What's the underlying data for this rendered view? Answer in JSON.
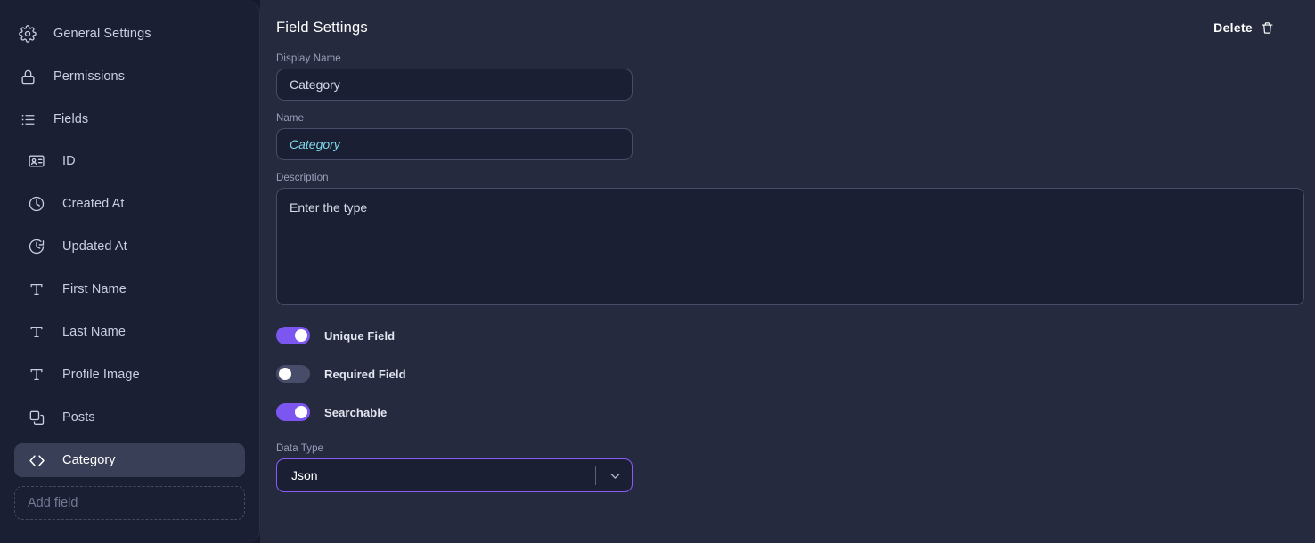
{
  "sidebar": {
    "nav": [
      {
        "label": "General Settings",
        "icon": "gear-icon"
      },
      {
        "label": "Permissions",
        "icon": "lock-icon"
      },
      {
        "label": "Fields",
        "icon": "list-icon"
      }
    ],
    "fields": [
      {
        "label": "ID",
        "icon": "id-card-icon",
        "active": false
      },
      {
        "label": "Created At",
        "icon": "clock-icon",
        "active": false
      },
      {
        "label": "Updated At",
        "icon": "clock-refresh-icon",
        "active": false
      },
      {
        "label": "First Name",
        "icon": "text-icon",
        "active": false
      },
      {
        "label": "Last Name",
        "icon": "text-icon",
        "active": false
      },
      {
        "label": "Profile Image",
        "icon": "text-icon",
        "active": false
      },
      {
        "label": "Posts",
        "icon": "copy-icon",
        "active": false
      },
      {
        "label": "Category",
        "icon": "code-icon",
        "active": true
      }
    ],
    "add_field_label": "Add field"
  },
  "header": {
    "title": "Field Settings",
    "delete_label": "Delete",
    "delete_icon": "trash-icon"
  },
  "form": {
    "display_name": {
      "label": "Display Name",
      "value": "Category",
      "placeholder": ""
    },
    "name": {
      "label": "Name",
      "value": "Category",
      "placeholder": ""
    },
    "description": {
      "label": "Description",
      "value": "Enter the type",
      "placeholder": ""
    },
    "toggles": [
      {
        "label": "Unique Field",
        "on": true
      },
      {
        "label": "Required Field",
        "on": false
      },
      {
        "label": "Searchable",
        "on": true
      }
    ],
    "data_type": {
      "label": "Data Type",
      "value": "Json",
      "options": [
        "Json"
      ],
      "icon": "chevron-down-icon"
    }
  },
  "colors": {
    "accent": "#7c56f0",
    "focus_border": "#8a5cf5",
    "sidebar_bg": "#1b1f33",
    "main_bg": "#252a3e",
    "name_value": "#7fd9ea"
  }
}
